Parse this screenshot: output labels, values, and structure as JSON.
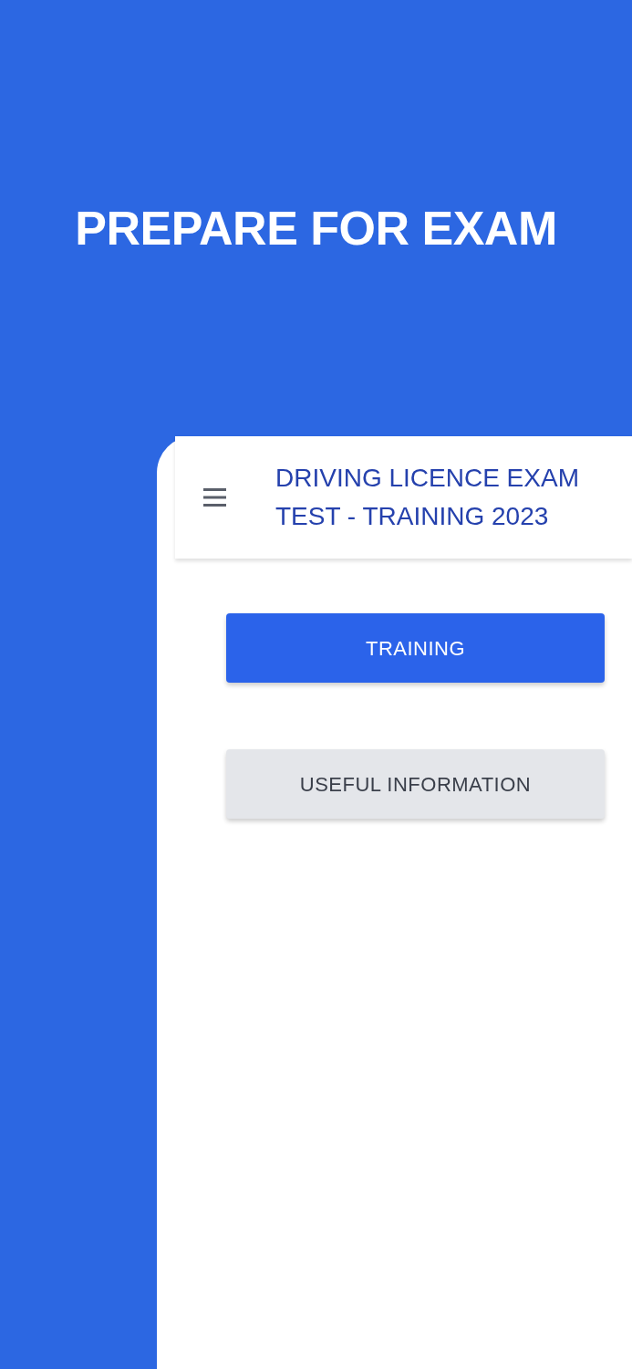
{
  "headline": "PREPARE FOR EXAM",
  "app_bar": {
    "title": "DRIVING LICENCE EXAM TEST - TRAINING 2023"
  },
  "buttons": [
    {
      "label": "TRAINING",
      "kind": "primary"
    },
    {
      "label": "USEFUL INFORMATION",
      "kind": "secondary"
    }
  ]
}
